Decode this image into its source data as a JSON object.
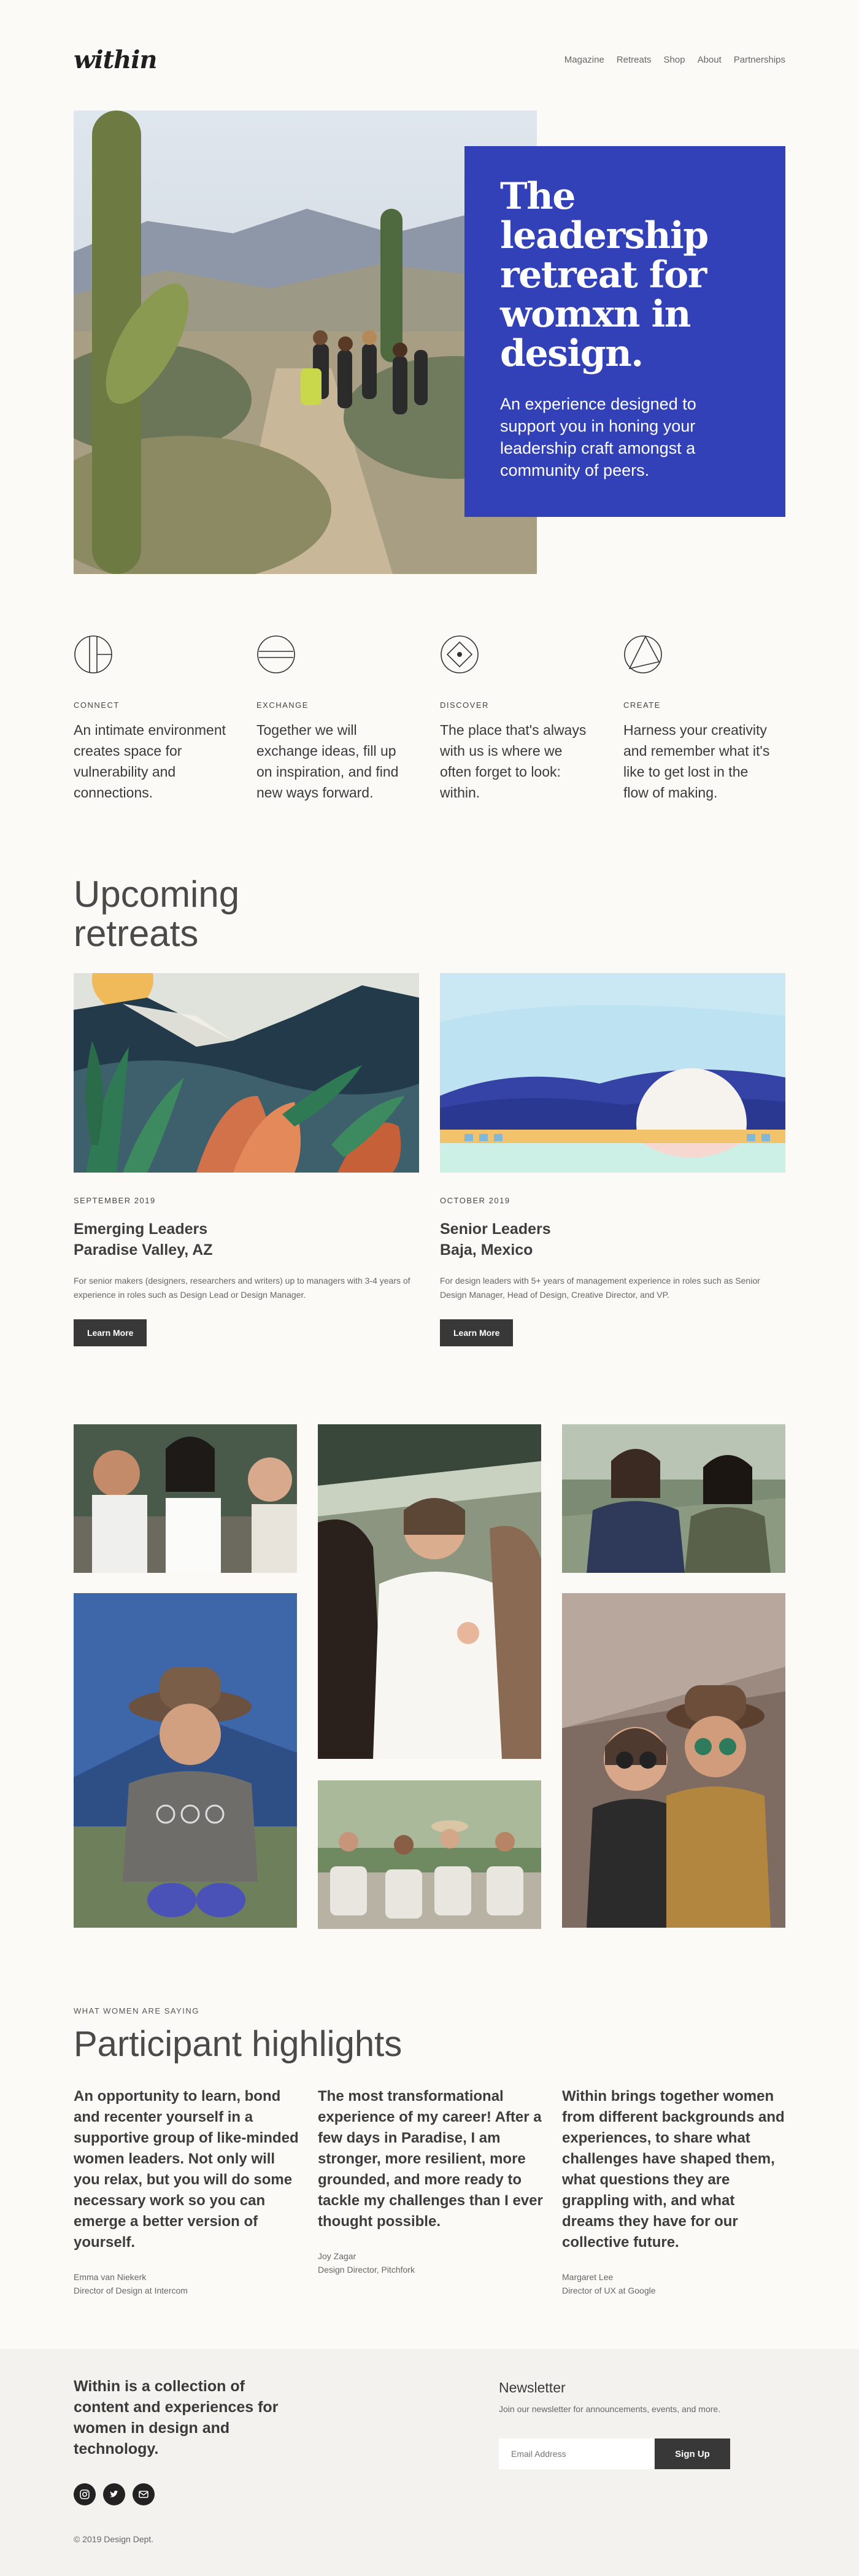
{
  "header": {
    "logo": "within",
    "nav": [
      "Magazine",
      "Retreats",
      "Shop",
      "About",
      "Partnerships"
    ]
  },
  "hero": {
    "title": "The leadership retreat for womxn in design.",
    "subtitle": "An experience designed to support you in honing your leadership craft amongst a community of peers."
  },
  "features": [
    {
      "icon": "circle-split-icon",
      "label": "CONNECT",
      "text": "An intimate environment creates space for vulnerability and connections."
    },
    {
      "icon": "circle-lines-icon",
      "label": "EXCHANGE",
      "text": "Together we will exchange ideas, fill up on inspiration, and find new ways forward."
    },
    {
      "icon": "circle-diamond-icon",
      "label": "DISCOVER",
      "text": "The place that's always with us is where we often forget to look: within."
    },
    {
      "icon": "circle-triangle-icon",
      "label": "CREATE",
      "text": "Harness your creativity and remember what it's like to get lost in the flow of making."
    }
  ],
  "retreats": {
    "heading": "Upcoming retreats",
    "items": [
      {
        "date": "SEPTEMBER 2019",
        "title": "Emerging Leaders",
        "location": "Paradise Valley, AZ",
        "desc": "For senior makers (designers, researchers and writers) up to managers with 3-4 years of experience in roles such as Design Lead or Design Manager.",
        "button": "Learn More"
      },
      {
        "date": "OCTOBER 2019",
        "title": "Senior Leaders",
        "location": "Baja, Mexico",
        "desc": "For design leaders with 5+ years of management experience in roles such as Senior Design Manager, Head of Design, Creative Director, and VP.",
        "button": "Learn More"
      }
    ]
  },
  "highlights": {
    "eyebrow": "WHAT WOMEN ARE SAYING",
    "title": "Participant highlights",
    "quotes": [
      {
        "text": "An opportunity to learn, bond and recenter yourself in a supportive group of like-minded women leaders. Not only will you relax, but you will do some necessary work so you can emerge a better version of yourself.",
        "name": "Emma van Niekerk",
        "role": "Director of Design at Intercom"
      },
      {
        "text": "The most transformational experience of my career! After a few days in Paradise, I am stronger, more resilient, more grounded, and more ready to tackle my challenges than I ever thought possible.",
        "name": "Joy Zagar",
        "role": "Design Director, Pitchfork"
      },
      {
        "text": "Within brings together women from different backgrounds and experiences, to share what challenges have shaped them, what questions they are grappling with, and what dreams they have for our collective future.",
        "name": "Margaret Lee",
        "role": "Director of UX at Google"
      }
    ]
  },
  "footer": {
    "tagline": "Within is a collection of content and experiences for women in design and technology.",
    "copyright": "© 2019 Design Dept.",
    "newsletter_title": "Newsletter",
    "newsletter_sub": "Join our newsletter for announcements, events, and more.",
    "email_placeholder": "Email Address",
    "signup": "Sign Up",
    "socials": [
      "instagram-icon",
      "twitter-icon",
      "email-icon"
    ]
  },
  "colors": {
    "accent": "#3341b9",
    "button": "#383838",
    "background": "#fbfaf6"
  }
}
